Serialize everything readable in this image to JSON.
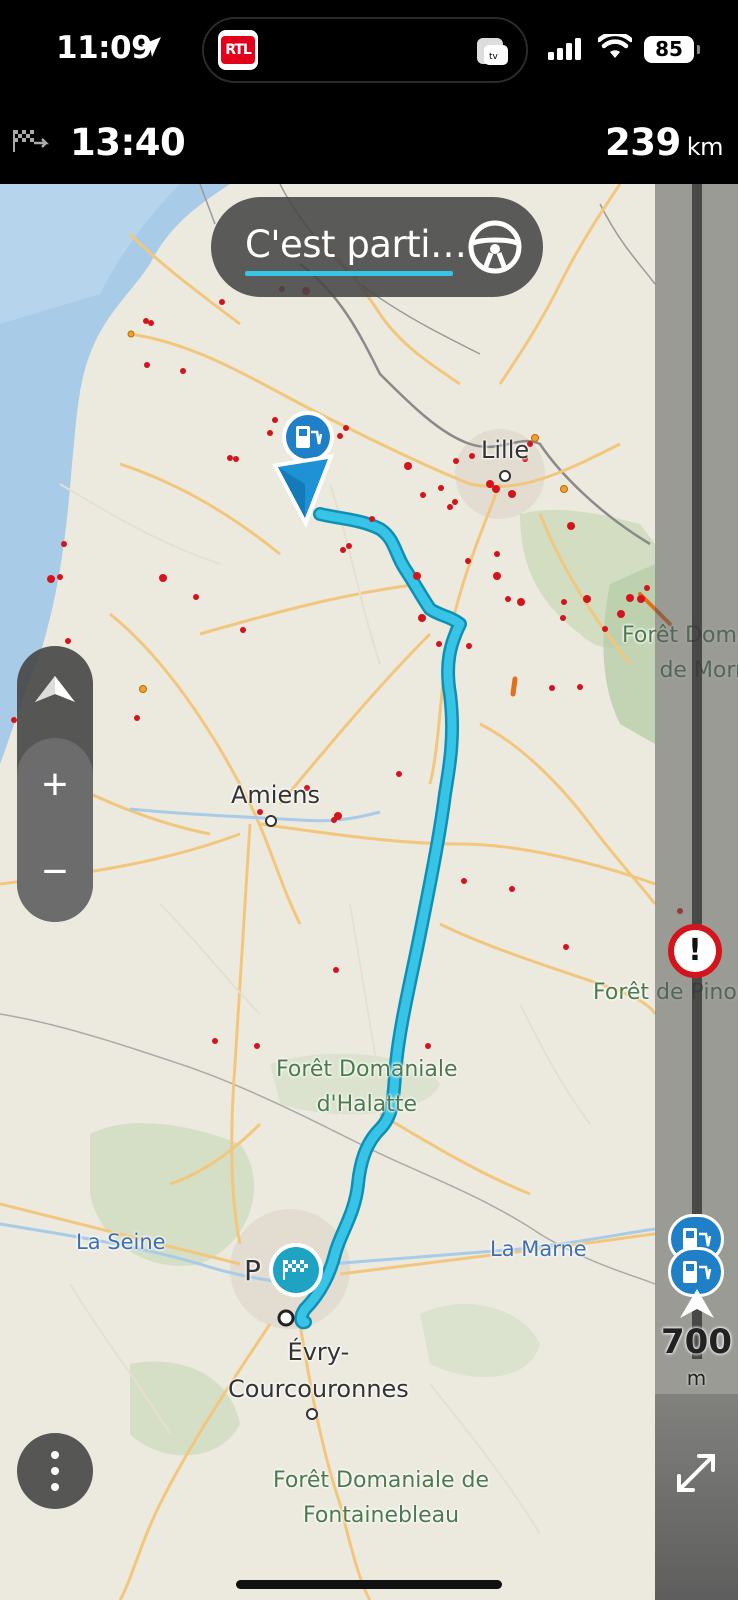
{
  "status_bar": {
    "time": "11:09",
    "media_app": "RTL",
    "battery": "85"
  },
  "nav_header": {
    "arrival_time": "13:40",
    "remaining_distance": "239",
    "distance_unit": "km"
  },
  "banner": {
    "text": "C'est parti…"
  },
  "map_labels": {
    "lille": "Lille",
    "amiens": "Amiens",
    "paris": "P",
    "evry_line1": "Évry-",
    "evry_line2": "Courcouronnes",
    "foret_halatte_line1": "Forêt Domaniale",
    "foret_halatte_line2": "d'Halatte",
    "foret_mormal_line1": "Forêt Domai",
    "foret_mormal_line2": "de Morm",
    "foret_pinon": "Forêt de Pinon",
    "foret_fontainebleau_line1": "Forêt Domaniale de",
    "foret_fontainebleau_line2": "Fontainebleau",
    "la_seine": "La Seine",
    "la_marne": "La Marne"
  },
  "zoom_control": {
    "plus": "+",
    "minus": "−"
  },
  "route_bar": {
    "next_distance": "700",
    "next_unit": "m",
    "warning_symbol": "!"
  },
  "colors": {
    "route": "#38c4e6",
    "route_border": "#0f8fb3",
    "incident": "#d4141c",
    "fuel_marker": "#1f7fc7"
  }
}
